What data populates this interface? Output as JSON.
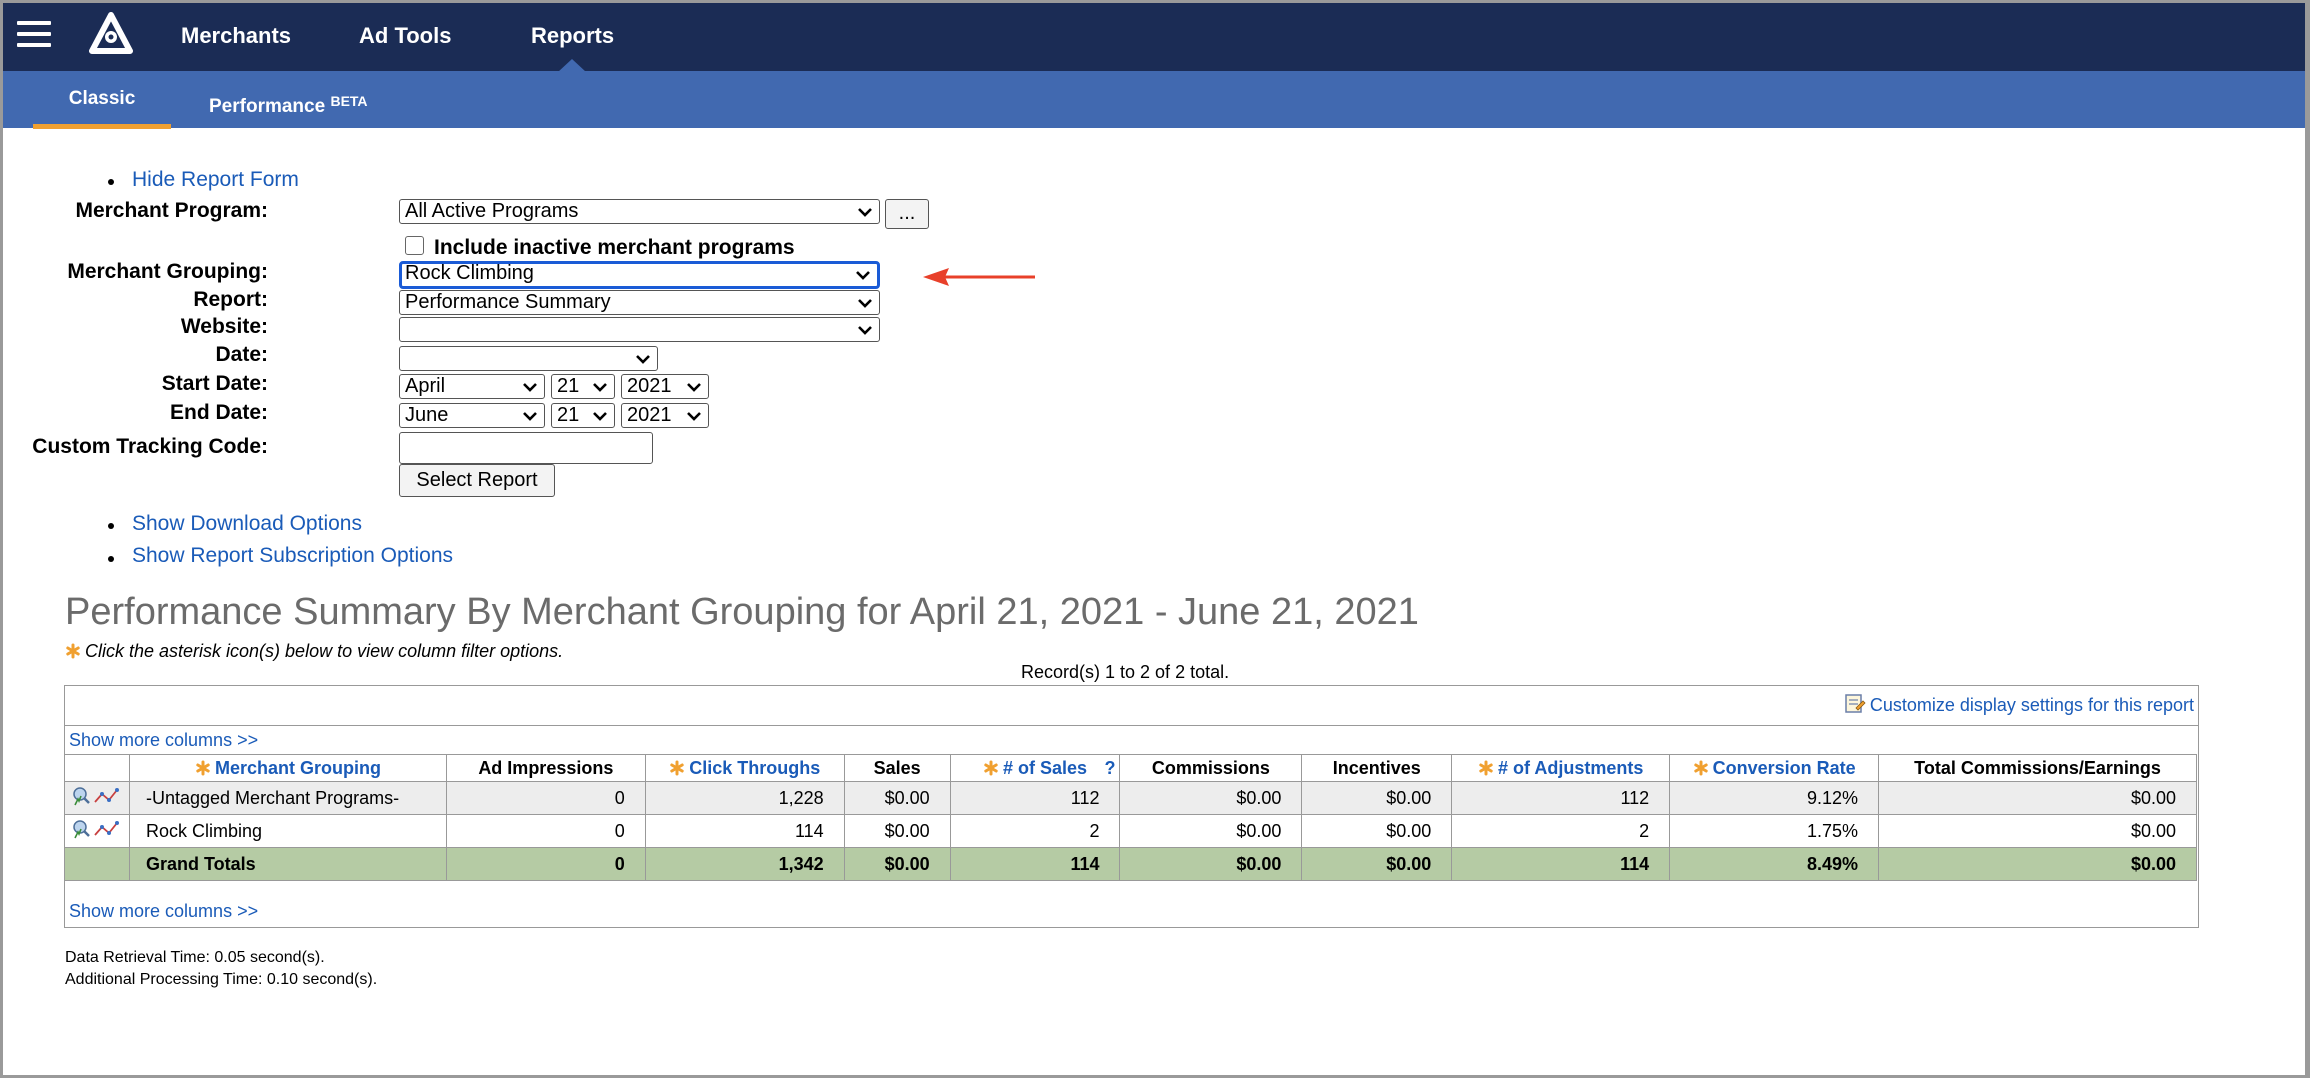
{
  "nav": {
    "items": [
      "Merchants",
      "Ad Tools",
      "Reports"
    ],
    "active": "Reports"
  },
  "subnav": {
    "classic": "Classic",
    "performance": "Performance",
    "performance_badge": "BETA"
  },
  "form": {
    "hide_link": "Hide Report Form",
    "merchant_program_label": "Merchant Program:",
    "merchant_program_value": "All Active Programs",
    "more_button": "...",
    "include_inactive_label": "Include inactive merchant programs",
    "include_inactive_checked": false,
    "merchant_grouping_label": "Merchant Grouping:",
    "merchant_grouping_value": "Rock Climbing",
    "report_label": "Report:",
    "report_value": "Performance Summary",
    "website_label": "Website:",
    "website_value": "",
    "date_label": "Date:",
    "date_value": "",
    "start_date_label": "Start Date:",
    "start_month": "April",
    "start_day": "21",
    "start_year": "2021",
    "end_date_label": "End Date:",
    "end_month": "June",
    "end_day": "21",
    "end_year": "2021",
    "tracking_label": "Custom Tracking Code:",
    "tracking_value": "",
    "submit": "Select Report",
    "download_link": "Show Download Options",
    "subscription_link": "Show Report Subscription Options"
  },
  "report": {
    "title": "Performance Summary By Merchant Grouping for April 21, 2021 - June 21, 2021",
    "hint": "Click the asterisk icon(s) below to view column filter options.",
    "records": "Record(s) 1 to 2 of 2 total.",
    "customize": "Customize display settings for this report",
    "more_columns": "Show more columns >>",
    "columns": [
      "Merchant Grouping",
      "Ad Impressions",
      "Click Throughs",
      "Sales",
      "# of Sales",
      "Commissions",
      "Incentives",
      "# of Adjustments",
      "Conversion Rate",
      "Total Commissions/Earnings"
    ],
    "sales_help": "?",
    "rows": [
      {
        "name": "-Untagged Merchant Programs-",
        "impressions": "0",
        "clicks": "1,228",
        "sales": "$0.00",
        "num_sales": "112",
        "commissions": "$0.00",
        "incentives": "$0.00",
        "adjustments": "112",
        "conversion": "9.12%",
        "total": "$0.00"
      },
      {
        "name": "Rock Climbing",
        "impressions": "0",
        "clicks": "114",
        "sales": "$0.00",
        "num_sales": "2",
        "commissions": "$0.00",
        "incentives": "$0.00",
        "adjustments": "2",
        "conversion": "1.75%",
        "total": "$0.00"
      }
    ],
    "totals": {
      "name": "Grand Totals",
      "impressions": "0",
      "clicks": "1,342",
      "sales": "$0.00",
      "num_sales": "114",
      "commissions": "$0.00",
      "incentives": "$0.00",
      "adjustments": "114",
      "conversion": "8.49%",
      "total": "$0.00"
    },
    "retrieval_time": "Data Retrieval Time: 0.05 second(s).",
    "processing_time": "Additional Processing Time: 0.10 second(s)."
  },
  "colors": {
    "nav_bg": "#1b2c55",
    "subnav_bg": "#4169b0",
    "tab_underline": "#f0a030",
    "link": "#1a5bb8",
    "totals_bg": "#b5cba4",
    "annotation_arrow": "#e8402a"
  },
  "icons": [
    "menu-icon",
    "logo",
    "chevron-down-icon",
    "asterisk-icon",
    "customize-settings-icon",
    "row-detail-icon",
    "row-trend-icon",
    "annotation-arrow"
  ]
}
